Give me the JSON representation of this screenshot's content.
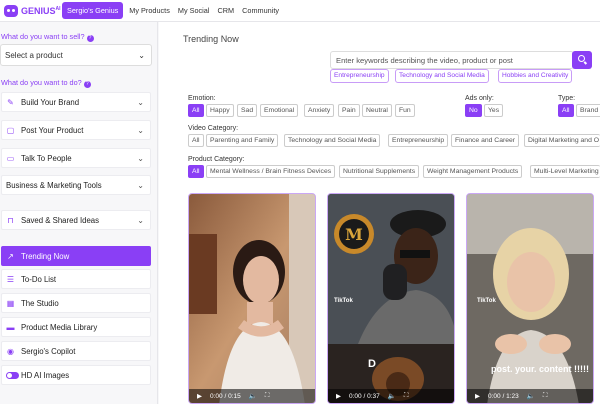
{
  "logo": {
    "text": "GENIUS",
    "sup": "AI"
  },
  "nav": {
    "items": [
      "Sergio's Genius",
      "My Products",
      "My Social",
      "CRM",
      "Community"
    ]
  },
  "sidebar": {
    "sell_question": "What do you want to sell?",
    "product_select": "Select a product",
    "do_question": "What do you want to do?",
    "items": [
      {
        "label": "Build Your Brand",
        "icon": "pencil-icon",
        "chevron": true
      },
      {
        "label": "Post Your Product",
        "icon": "post-icon",
        "chevron": true
      },
      {
        "label": "Talk To People",
        "icon": "chat-icon",
        "chevron": true
      },
      {
        "label": "Business & Marketing Tools",
        "icon": "",
        "chevron": true
      },
      {
        "label": "Saved & Shared Ideas",
        "icon": "bookmark-icon",
        "chevron": true
      },
      {
        "label": "Trending Now",
        "icon": "trend-icon",
        "active": true
      },
      {
        "label": "To-Do List",
        "icon": "list-icon"
      },
      {
        "label": "The Studio",
        "icon": "studio-icon"
      },
      {
        "label": "Product Media Library",
        "icon": "library-icon"
      },
      {
        "label": "Sergio's Copilot",
        "icon": "copilot-icon"
      },
      {
        "label": "HD AI Images",
        "icon": "toggle"
      }
    ]
  },
  "main": {
    "title": "Trending Now",
    "search_placeholder": "Enter keywords describing the video, product or post",
    "suggestions": [
      "Entrepreneurship",
      "Technology and Social Media",
      "Hobbies and Creativity"
    ],
    "emotion_label": "Emotion:",
    "emotions": [
      "All",
      "Happy",
      "Sad",
      "Emotional",
      "Anxiety",
      "Pain",
      "Neutral",
      "Fun"
    ],
    "ads_label": "Ads only:",
    "ads": [
      "No",
      "Yes"
    ],
    "type_label": "Type:",
    "types": [
      "All",
      "Brand"
    ],
    "video_category_label": "Video Category:",
    "video_categories": [
      "All",
      "Parenting and Family",
      "Technology and Social Media",
      "Entrepreneurship",
      "Finance and Career",
      "Digital Marketing and O"
    ],
    "product_category_label": "Product Category:",
    "product_categories": [
      "All",
      "Mental Wellness / Brain Fitness Devices",
      "Nutritional Supplements",
      "Weight Management Products",
      "Multi-Level Marketing"
    ],
    "videos": [
      {
        "time": "0:00 / 0:15"
      },
      {
        "time": "0:00 / 0:37",
        "brand": "TikTok",
        "overlay": "D"
      },
      {
        "time": "0:00 / 1:23",
        "brand": "TikTok",
        "caption": "post. your. content !!!!!"
      }
    ]
  },
  "colors": {
    "accent": "#8a3ff5"
  }
}
